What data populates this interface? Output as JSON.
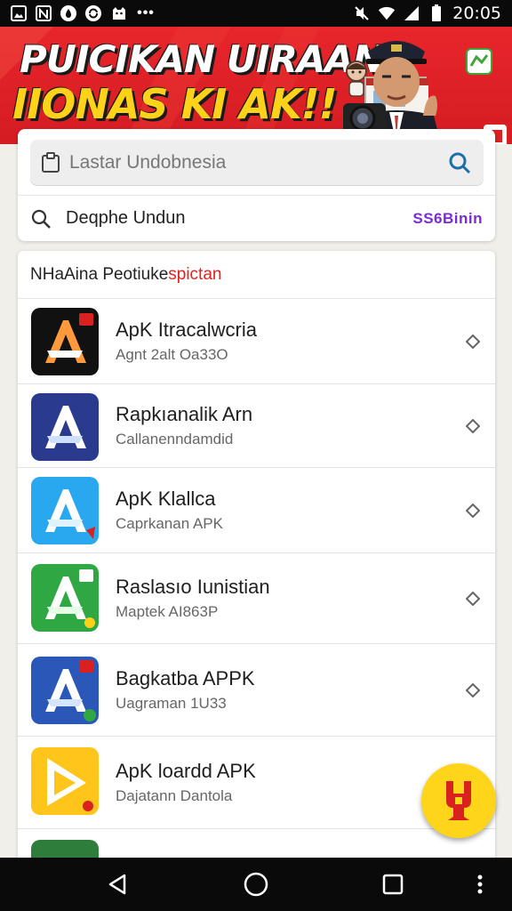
{
  "status_bar": {
    "time": "20:05",
    "left_icons": [
      "image-icon",
      "n-icon",
      "drop-icon",
      "sync-icon",
      "cat-icon",
      "more-dots-icon"
    ],
    "right_icons": [
      "mute-icon",
      "wifi-icon",
      "signal-icon",
      "battery-icon"
    ]
  },
  "banner": {
    "line1": "PUICIKAN UIRAAN",
    "line2": "IIONAS KI AK!!"
  },
  "search": {
    "placeholder": "Lastar Undobnesia",
    "suggestion": "Deqphe Undun",
    "suggestion_action": "SS6Binin"
  },
  "list": {
    "title_main": "NHaAina Peotiuke",
    "title_accent": "spictan",
    "apps": [
      {
        "name": "ApK Itracalwcria",
        "subtitle": "Agnt 2alt Oa33O",
        "icon_bg": "#111111",
        "icon_fg": "#ff9a3c",
        "icon": "app-a-icon"
      },
      {
        "name": "Rapkıanalik Arn",
        "subtitle": "Callanenndamdid",
        "icon_bg": "#2a3a8f",
        "icon_fg": "#ffffff",
        "icon": "app-a-icon"
      },
      {
        "name": "ApK Klallca",
        "subtitle": "Caprkanan APK",
        "icon_bg": "#2aa8ef",
        "icon_fg": "#ffffff",
        "icon": "app-a-icon"
      },
      {
        "name": "Raslasıo Iunistian",
        "subtitle": "Maptek AI863P",
        "icon_bg": "#2fa843",
        "icon_fg": "#ffffff",
        "icon": "app-a-icon"
      },
      {
        "name": "Bagkatba APPK",
        "subtitle": "Uagraman 1U33",
        "icon_bg": "#2a57b8",
        "icon_fg": "#ffffff",
        "icon": "app-a-icon"
      },
      {
        "name": "ApK loardd APK",
        "subtitle": "Dajatann Dantola",
        "icon_bg": "#ffc51a",
        "icon_fg": "#ffffff",
        "icon": "app-play-icon"
      }
    ]
  },
  "fab": {
    "icon": "indonesia-map-icon",
    "color": "#ffd51c"
  },
  "nav": {
    "icons": [
      "back-icon",
      "home-icon",
      "recents-icon",
      "menu-dots-icon"
    ]
  },
  "colors": {
    "accent_red": "#e0211f",
    "accent_purple": "#7b2bd6",
    "banner_red": "#e8262c",
    "banner_yellow": "#ffd21a"
  }
}
